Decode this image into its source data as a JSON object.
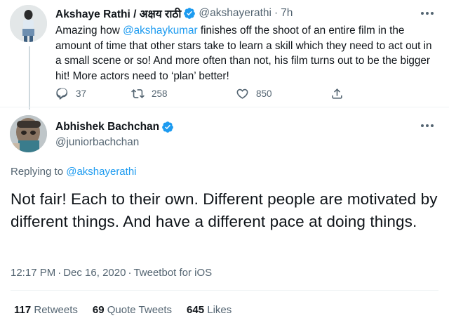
{
  "parent_tweet": {
    "display_name": "Akshaye Rathi / अक्षय राठी",
    "handle": "@akshayerathi",
    "separator": "·",
    "time_ago": "7h",
    "text_before_mention": "Amazing how ",
    "mention": "@akshaykumar",
    "text_after_mention": " finishes off the shoot of an entire film in the amount of time that other stars take to learn a skill which they need to act out in a small scene or so! And more often than not, his film turns out to be the bigger hit! More actors need to ‘plan’ better!",
    "actions": {
      "replies": "37",
      "retweets": "258",
      "likes": "850"
    }
  },
  "main_tweet": {
    "display_name": "Abhishek Bachchan",
    "handle": "@juniorbachchan",
    "replying_prefix": "Replying to ",
    "replying_to": "@akshayerathi",
    "text": "Not fair! Each to their own. Different people are motivated by different things. And have a different pace at doing things.",
    "time": "12:17 PM",
    "date": "Dec 16, 2020",
    "source": "Tweetbot for iOS",
    "dot": "·",
    "stats": {
      "retweets_count": "117",
      "retweets_label": "Retweets",
      "quotes_count": "69",
      "quotes_label": "Quote Tweets",
      "likes_count": "645",
      "likes_label": "Likes"
    }
  },
  "colors": {
    "accent": "#1d9bf0",
    "muted": "#536471",
    "text": "#0f1419",
    "divider": "#eff3f4"
  },
  "icons": [
    "verified-badge-icon",
    "more-options-icon",
    "reply-icon",
    "retweet-icon",
    "like-icon",
    "share-icon"
  ]
}
